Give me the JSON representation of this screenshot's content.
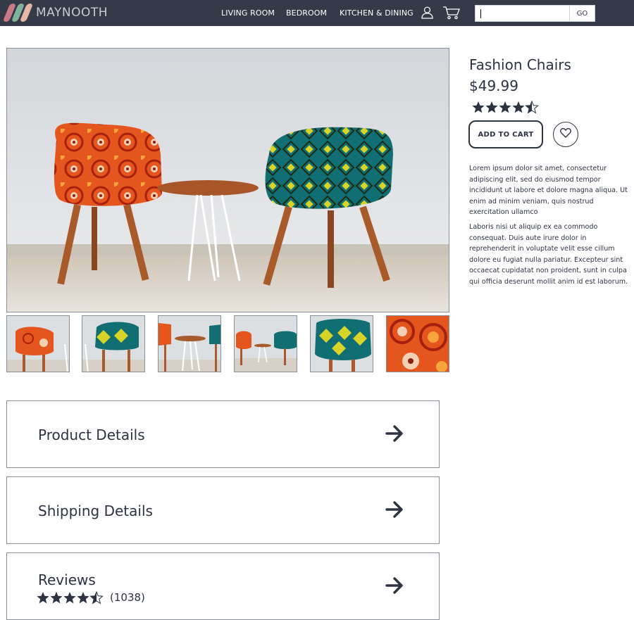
{
  "header": {
    "logo_text": "MAYNOOTH",
    "logo_colors": [
      "#c97a86",
      "#7fb49b",
      "#e6b7a6"
    ],
    "nav": [
      {
        "label": "LIVING ROOM"
      },
      {
        "label": "BEDROOM"
      },
      {
        "label": "KITCHEN & DINING"
      }
    ],
    "account_icon": "user-icon",
    "cart_icon": "cart-icon",
    "search": {
      "value": "",
      "placeholder": ""
    },
    "go_label": "GO"
  },
  "gallery": {
    "main_image": "two-patterned-chairs-photo",
    "thumbnails": [
      "orange-chair",
      "teal-chair",
      "table-with-chairs",
      "chairs-wide",
      "teal-chair-closeup",
      "orange-pattern-closeup"
    ]
  },
  "product": {
    "name": "Fashion Chairs",
    "price": "$49.99",
    "rating": 4.5,
    "add_to_cart_label": "ADD TO CART",
    "wishlist_icon": "heart-icon",
    "description": [
      "Lorem ipsum dolor sit amet, consectetur adipiscing elit, sed do eiusmod tempor incididunt ut labore et dolore magna aliqua. Ut enim ad minim veniam, quis nostrud exercitation ullamco",
      "Laboris nisi ut aliquip ex ea commodo consequat. Duis aute irure dolor in reprehenderit in voluptate velit esse cillum dolore eu fugiat nulla pariatur. Excepteur sint occaecat cupidatat non proident, sunt in culpa qui officia deserunt mollit anim id est laborum."
    ]
  },
  "sections": [
    {
      "title": "Product Details",
      "icon": "arrow-right-icon"
    },
    {
      "title": "Shipping Details",
      "icon": "arrow-right-icon"
    },
    {
      "title": "Reviews",
      "icon": "arrow-right-icon",
      "rating": 4.5,
      "count": "(1038)"
    }
  ],
  "colors": {
    "navbar": "#343a48",
    "text": "#2d3340",
    "border": "#8a8f98"
  }
}
